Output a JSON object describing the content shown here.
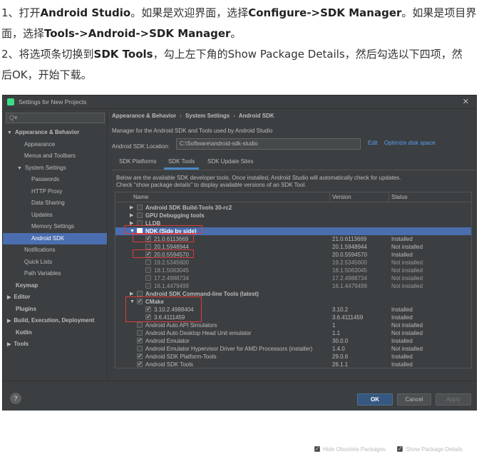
{
  "article": {
    "line1a": "1、打开",
    "line1b": "Android Studio",
    "line1c": "。如果是欢迎界面，选择",
    "line1d": "Configure->SDK Manager",
    "line1e": "。如果是项目界",
    "line2a": "面，选择",
    "line2b": "Tools->Android->SDK Manager",
    "line2c": "。",
    "line3a": "2、将选项条切换到",
    "line3b": "SDK Tools",
    "line3c": "，勾上左下角的Show Package Details，然后勾选以下四项，然",
    "line4": "后OK，开始下载。"
  },
  "window": {
    "title": "Settings for New Projects",
    "close": "✕"
  },
  "search": {
    "placeholder": "Q▾"
  },
  "sidebar": {
    "items": [
      {
        "label": "Appearance & Behavior",
        "arrow": "▼"
      },
      {
        "label": "Appearance"
      },
      {
        "label": "Menus and Toolbars"
      },
      {
        "label": "System Settings",
        "arrow": "▼"
      },
      {
        "label": "Passwords"
      },
      {
        "label": "HTTP Proxy"
      },
      {
        "label": "Data Sharing"
      },
      {
        "label": "Updates"
      },
      {
        "label": "Memory Settings"
      },
      {
        "label": "Android SDK"
      },
      {
        "label": "Notifications"
      },
      {
        "label": "Quick Lists"
      },
      {
        "label": "Path Variables"
      },
      {
        "label": "Keymap"
      },
      {
        "label": "Editor",
        "arrow": "▶"
      },
      {
        "label": "Plugins"
      },
      {
        "label": "Build, Execution, Deployment",
        "arrow": "▶"
      },
      {
        "label": "Kotlin"
      },
      {
        "label": "Tools",
        "arrow": "▶"
      }
    ]
  },
  "breadcrumb": {
    "a": "Appearance & Behavior",
    "b": "System Settings",
    "c": "Android SDK",
    "sep": "›"
  },
  "main": {
    "description": "Manager for the Android SDK and Tools used by Android Studio",
    "location_label": "Android SDK Location:",
    "location_value": "C:\\Software\\android-sdk-studio",
    "edit": "Edit",
    "optimize": "Optimize disk space",
    "tabs": [
      "SDK Platforms",
      "SDK Tools",
      "SDK Update Sites"
    ],
    "info": "Below are the available SDK developer tools. Once installed, Android Studio will automatically check for updates. Check \"show package details\" to display available versions of an SDK Tool."
  },
  "table": {
    "headers": [
      "Name",
      "Version",
      "Status"
    ],
    "rows": [
      {
        "name": "Android SDK Build-Tools 30-rc2",
        "version": "",
        "status": ""
      },
      {
        "name": "GPU Debugging tools",
        "version": "",
        "status": ""
      },
      {
        "name": "LLDB",
        "version": "",
        "status": ""
      },
      {
        "name": "NDK (Side by side)",
        "version": "",
        "status": ""
      },
      {
        "name": "21.0.6113669",
        "version": "21.0.6113669",
        "status": "Installed"
      },
      {
        "name": "20.1.5948944",
        "version": "20.1.5948944",
        "status": "Not installed"
      },
      {
        "name": "20.0.5594570",
        "version": "20.0.5594570",
        "status": "Installed"
      },
      {
        "name": "19.2.5345600",
        "version": "19.2.5345600",
        "status": "Not installed"
      },
      {
        "name": "18.1.5063045",
        "version": "18.1.5063045",
        "status": "Not installed"
      },
      {
        "name": "17.2.4988734",
        "version": "17.2.4988734",
        "status": "Not installed"
      },
      {
        "name": "16.1.4479499",
        "version": "16.1.4479499",
        "status": "Not installed"
      },
      {
        "name": "Android SDK Command-line Tools (latest)",
        "version": "",
        "status": ""
      },
      {
        "name": "CMake",
        "version": "",
        "status": ""
      },
      {
        "name": "3.10.2.4988404",
        "version": "3.10.2",
        "status": "Installed"
      },
      {
        "name": "3.6.4111459",
        "version": "3.6.4111459",
        "status": "Installed"
      },
      {
        "name": "Android Auto API Simulators",
        "version": "1",
        "status": "Not installed"
      },
      {
        "name": "Android Auto Desktop Head Unit emulator",
        "version": "1.1",
        "status": "Not installed"
      },
      {
        "name": "Android Emulator",
        "version": "30.0.0",
        "status": "Installed"
      },
      {
        "name": "Android Emulator Hypervisor Driver for AMD Processors (installer)",
        "version": "1.4.0",
        "status": "Not installed"
      },
      {
        "name": "Android SDK Platform-Tools",
        "version": "29.0.6",
        "status": "Installed"
      },
      {
        "name": "Android SDK Tools",
        "version": "26.1.1",
        "status": "Installed"
      }
    ]
  },
  "options": {
    "hide_obsolete": "Hide Obsolete Packages",
    "show_details": "Show Package Details"
  },
  "footer": {
    "help": "?",
    "ok": "OK",
    "cancel": "Cancel",
    "apply": "Apply"
  },
  "colors": {
    "accent": "#4b6eaf",
    "link": "#589df6",
    "highlight": "#e03a3a"
  }
}
